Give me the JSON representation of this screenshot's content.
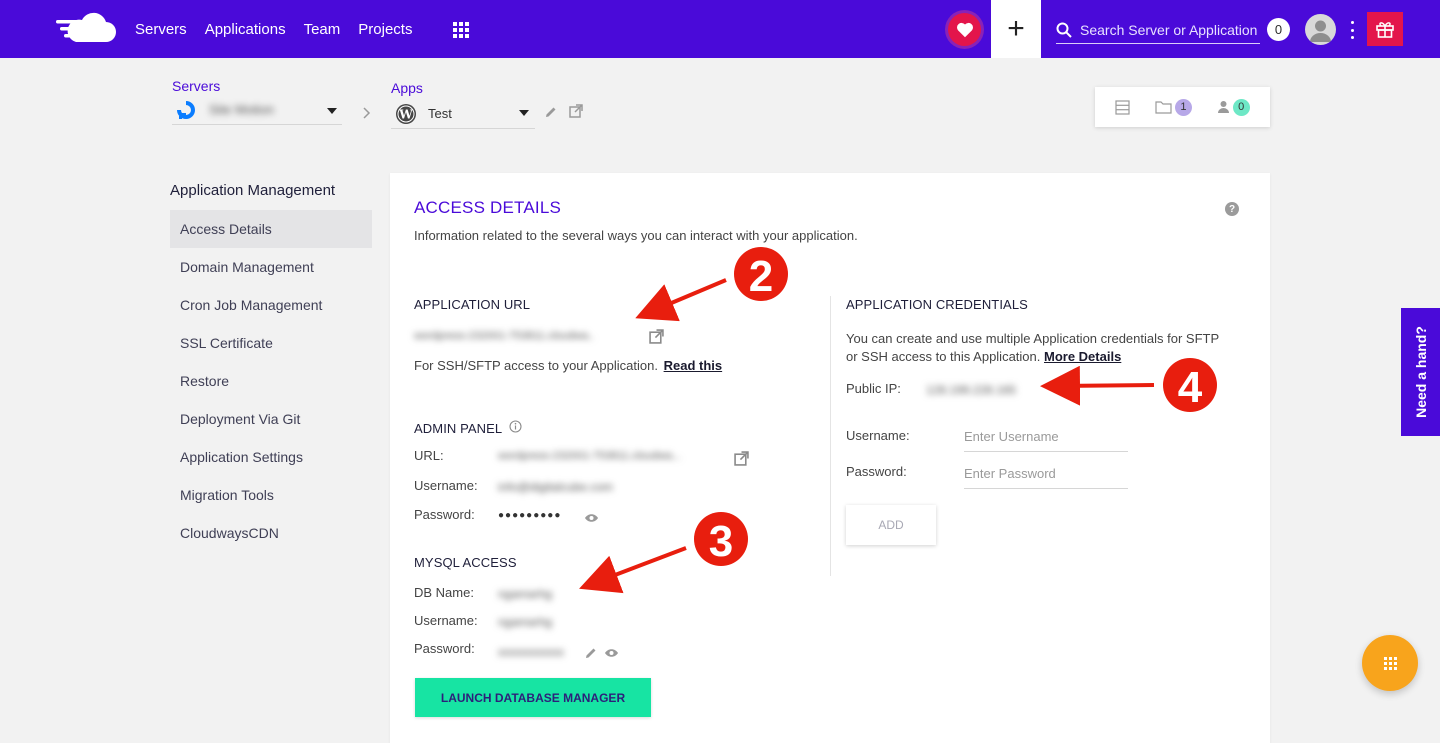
{
  "nav": {
    "items": [
      "Servers",
      "Applications",
      "Team",
      "Projects"
    ],
    "search_placeholder": "Search Server or Application",
    "notification_count": "0"
  },
  "breadcrumb": {
    "servers_label": "Servers",
    "server_name": "Site Motion",
    "apps_label": "Apps",
    "app_name": "Test"
  },
  "stats": {
    "projects": "1",
    "members": "0"
  },
  "sidebar": {
    "title": "Application Management",
    "items": [
      {
        "label": "Access Details",
        "active": true
      },
      {
        "label": "Domain Management"
      },
      {
        "label": "Cron Job Management"
      },
      {
        "label": "SSL Certificate"
      },
      {
        "label": "Restore"
      },
      {
        "label": "Deployment Via Git"
      },
      {
        "label": "Application Settings"
      },
      {
        "label": "Migration Tools"
      },
      {
        "label": "CloudwaysCDN"
      }
    ]
  },
  "access": {
    "title": "ACCESS DETAILS",
    "subtitle": "Information related to the several ways you can interact with your application.",
    "app_url": {
      "heading": "APPLICATION URL",
      "url": "wordpress-232001-753811.cloudwa..",
      "ssh_text": "For SSH/SFTP access to your Application.",
      "read_this": "Read this"
    },
    "admin": {
      "heading": "ADMIN PANEL",
      "url_label": "URL:",
      "url_value": "wordpress-232001-753811.cloudwa...",
      "username_label": "Username:",
      "username_value": "info@digitalcube.com",
      "password_label": "Password:",
      "password_value": "●●●●●●●●●"
    },
    "mysql": {
      "heading": "MYSQL ACCESS",
      "db_label": "DB Name:",
      "db_value": "ngamarhg",
      "username_label": "Username:",
      "username_value": "ngamarhg",
      "password_label": "Password:",
      "password_value": "xxxxxxxxxxx",
      "launch_button": "LAUNCH DATABASE MANAGER"
    },
    "credentials": {
      "heading": "APPLICATION CREDENTIALS",
      "desc_line1": "You can create and use multiple Application credentials for SFTP",
      "desc_line2": "or SSH access to this Application.",
      "more_details": "More Details",
      "public_ip_label": "Public IP:",
      "public_ip_value": "128.199.228.165",
      "username_label": "Username:",
      "username_placeholder": "Enter Username",
      "password_label": "Password:",
      "password_placeholder": "Enter Password",
      "add_button": "ADD"
    }
  },
  "need_hand": "Need a hand?",
  "annotations": [
    "2",
    "3",
    "4"
  ],
  "colors": {
    "brand": "#4a0ad9",
    "accent_red": "#e3154b",
    "launch_green": "#17e4a3",
    "fab_orange": "#f8a41c"
  }
}
